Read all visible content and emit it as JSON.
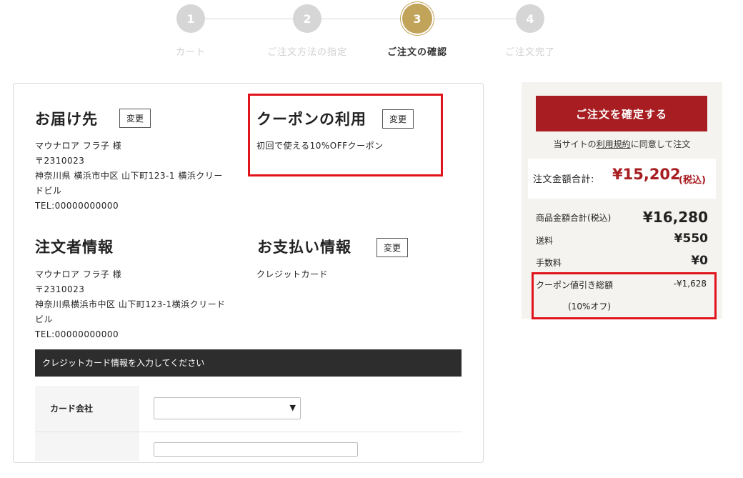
{
  "steps": [
    {
      "num": "1",
      "label": "カート"
    },
    {
      "num": "2",
      "label": "ご注文方法の指定"
    },
    {
      "num": "3",
      "label": "ご注文の確認"
    },
    {
      "num": "4",
      "label": "ご注文完了"
    }
  ],
  "delivery": {
    "title": "お届け先",
    "change": "変更",
    "name": "マウナロア フラ子 様",
    "zip": "〒2310023",
    "addr1": "神奈川県 横浜市中区 山下町123-1 横浜クリー",
    "addr2": "ドビル",
    "tel": "TEL:00000000000"
  },
  "coupon": {
    "title": "クーポンの利用",
    "change": "変更",
    "text": "初回で使える10%OFFクーポン"
  },
  "orderer": {
    "title": "注文者情報",
    "name": "マウナロア フラ子 様",
    "zip": "〒2310023",
    "addr1": "神奈川県横浜市中区 山下町123-1横浜クリード",
    "addr2": "ビル",
    "tel": "TEL:00000000000"
  },
  "payment": {
    "title": "お支払い情報",
    "change": "変更",
    "method": "クレジットカード"
  },
  "credit_card": {
    "header": "クレジットカード情報を入力してください",
    "company_label": "カード会社",
    "select_arrow": "▼"
  },
  "sidebar": {
    "confirm_button": "ご注文を確定する",
    "agree_before": "当サイトの",
    "agree_link": "利用規約",
    "agree_after": "に同意して注文",
    "total_label": "注文金額合計:",
    "total_value": "¥15,202",
    "total_tax": "(税込)",
    "subtotal_label": "商品金額合計(税込)",
    "subtotal_value": "¥16,280",
    "shipping_label": "送料",
    "shipping_value": "¥550",
    "fee_label": "手数料",
    "fee_value": "¥0",
    "coupon_label": "クーポン値引き総額",
    "coupon_value": "-¥1,628",
    "coupon_note": "(10%オフ)"
  },
  "colors": {
    "accent_gold": "#c2a35a",
    "brand_red": "#a71d21",
    "highlight_red": "#e0141a"
  }
}
